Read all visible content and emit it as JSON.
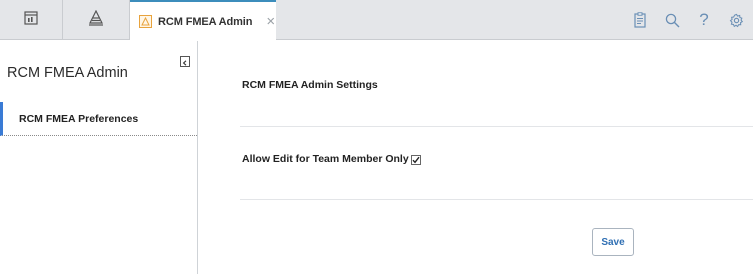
{
  "topbar": {
    "buttons": [
      {
        "icon": "dashboard-icon"
      },
      {
        "icon": "asset-hierarchy-icon"
      }
    ],
    "active_tab": {
      "icon": "rcm-warning-icon",
      "title": "RCM FMEA Admin",
      "close_glyph": "×"
    },
    "right_icons": [
      "clipboard-icon",
      "search-icon",
      "help-icon",
      "settings-icon"
    ],
    "help_glyph": "?"
  },
  "sidebar": {
    "title": "RCM FMEA Admin",
    "items": [
      {
        "label": "RCM FMEA Preferences",
        "selected": true
      }
    ]
  },
  "main": {
    "section_title": "RCM FMEA Admin Settings",
    "field_label": "Allow Edit for Team Member Only",
    "field_checked": true,
    "save_label": "Save"
  },
  "colors": {
    "accent": "#3a7bd5",
    "tab_bar": "#e4e6e9",
    "icon_blue": "#6a8fb5",
    "warning": "#e8a33d"
  }
}
